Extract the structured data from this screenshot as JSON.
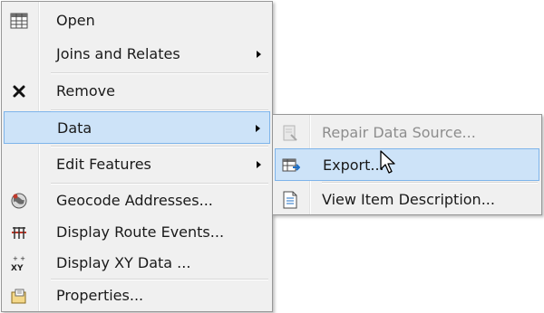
{
  "main_menu": {
    "items": [
      {
        "label": "Open",
        "icon": "attribute-table-icon"
      },
      {
        "label": "Joins and Relates",
        "submenu": true
      },
      {
        "label": "Remove",
        "icon": "remove-x-icon"
      },
      {
        "label": "Data",
        "submenu": true,
        "highlighted": true
      },
      {
        "label": "Edit Features",
        "submenu": true
      },
      {
        "label": "Geocode Addresses...",
        "icon": "geocode-icon"
      },
      {
        "label": "Display Route Events...",
        "icon": "route-events-icon"
      },
      {
        "label": "Display XY Data ...",
        "icon": "xy-data-icon"
      },
      {
        "label": "Properties...",
        "icon": "properties-icon"
      }
    ]
  },
  "data_submenu": {
    "items": [
      {
        "label": "Repair Data Source...",
        "icon": "repair-data-source-icon",
        "disabled": true
      },
      {
        "label": "Export...",
        "icon": "export-icon",
        "highlighted": true
      },
      {
        "label": "View Item Description...",
        "icon": "item-description-icon"
      }
    ]
  },
  "colors": {
    "menu_bg": "#f0f0f0",
    "highlight_bg": "#cde3f8",
    "highlight_border": "#7eb4ea",
    "disabled_text": "#8d8d8d"
  }
}
